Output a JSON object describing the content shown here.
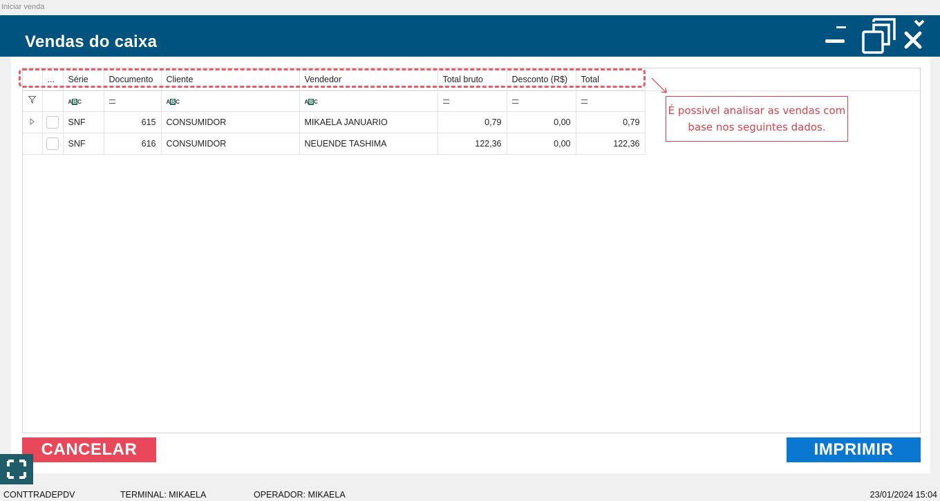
{
  "top_label": "Iniciar venda",
  "window": {
    "title": "Vendas do caixa",
    "controls": [
      "minimize-icon",
      "restore-icon",
      "close-icon"
    ]
  },
  "grid": {
    "columns": [
      "...",
      "Série",
      "Documento",
      "Cliente",
      "Vendedor",
      "Total bruto",
      "Desconto (R$)",
      "Total"
    ],
    "filter_row": {
      "serie": "ABC",
      "documento": "=",
      "cliente": "ABC",
      "vendedor": "ABC",
      "total_bruto": "=",
      "desconto": "=",
      "total": "="
    },
    "rows": [
      {
        "serie": "SNF",
        "documento": "615",
        "cliente": "CONSUMIDOR",
        "vendedor": "MIKAELA JANUARIO",
        "total_bruto": "0,79",
        "desconto": "0,00",
        "total": "0,79"
      },
      {
        "serie": "SNF",
        "documento": "616",
        "cliente": "CONSUMIDOR",
        "vendedor": "NEUENDE TASHIMA",
        "total_bruto": "122,36",
        "desconto": "0,00",
        "total": "122,36"
      }
    ]
  },
  "annotation": {
    "line1": "É possivel analisar as vendas com",
    "line2": "base nos seguintes dados."
  },
  "buttons": {
    "cancel": "CANCELAR",
    "print": "IMPRIMIR"
  },
  "status_bar": {
    "app": "CONTTRADEPDV",
    "terminal": "TERMINAL: MIKAELA",
    "operator": "OPERADOR: MIKAELA",
    "datetime": "23/01/2024 15:04"
  },
  "colors": {
    "titlebar": "#00527f",
    "cancel": "#e8485a",
    "print": "#0a78d0",
    "annotation": "#d9414c"
  }
}
